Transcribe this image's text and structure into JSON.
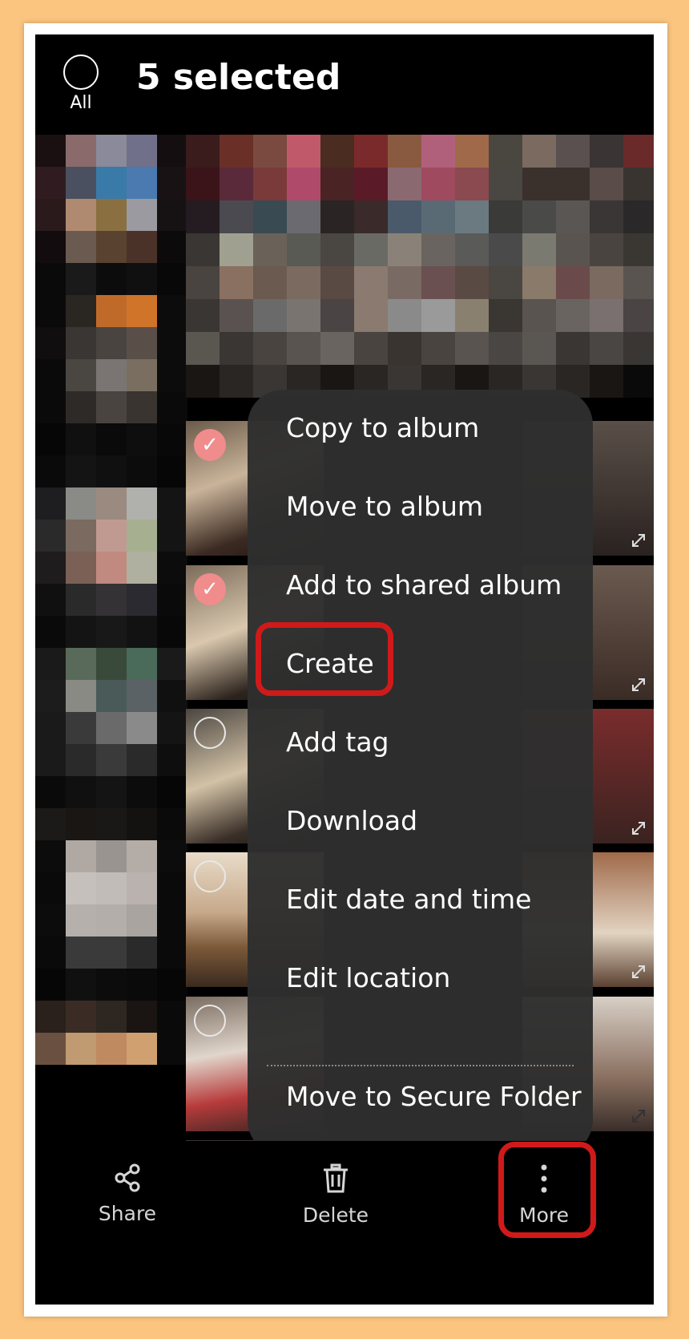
{
  "header": {
    "title": "5 selected",
    "all_label": "All"
  },
  "menu": {
    "items": [
      "Copy to album",
      "Move to album",
      "Add to shared album",
      "Create",
      "Add tag",
      "Download",
      "Edit date and time",
      "Edit location",
      "Move to Secure Folder"
    ]
  },
  "bottom_bar": {
    "share": "Share",
    "delete": "Delete",
    "more": "More"
  },
  "colors": {
    "highlight": "#d01a1a",
    "check": "#f08c8c",
    "menu_bg": "#2e2e2e"
  },
  "icons": [
    "share-icon",
    "trash-icon",
    "more-vertical-icon",
    "check-icon",
    "expand-icon"
  ]
}
